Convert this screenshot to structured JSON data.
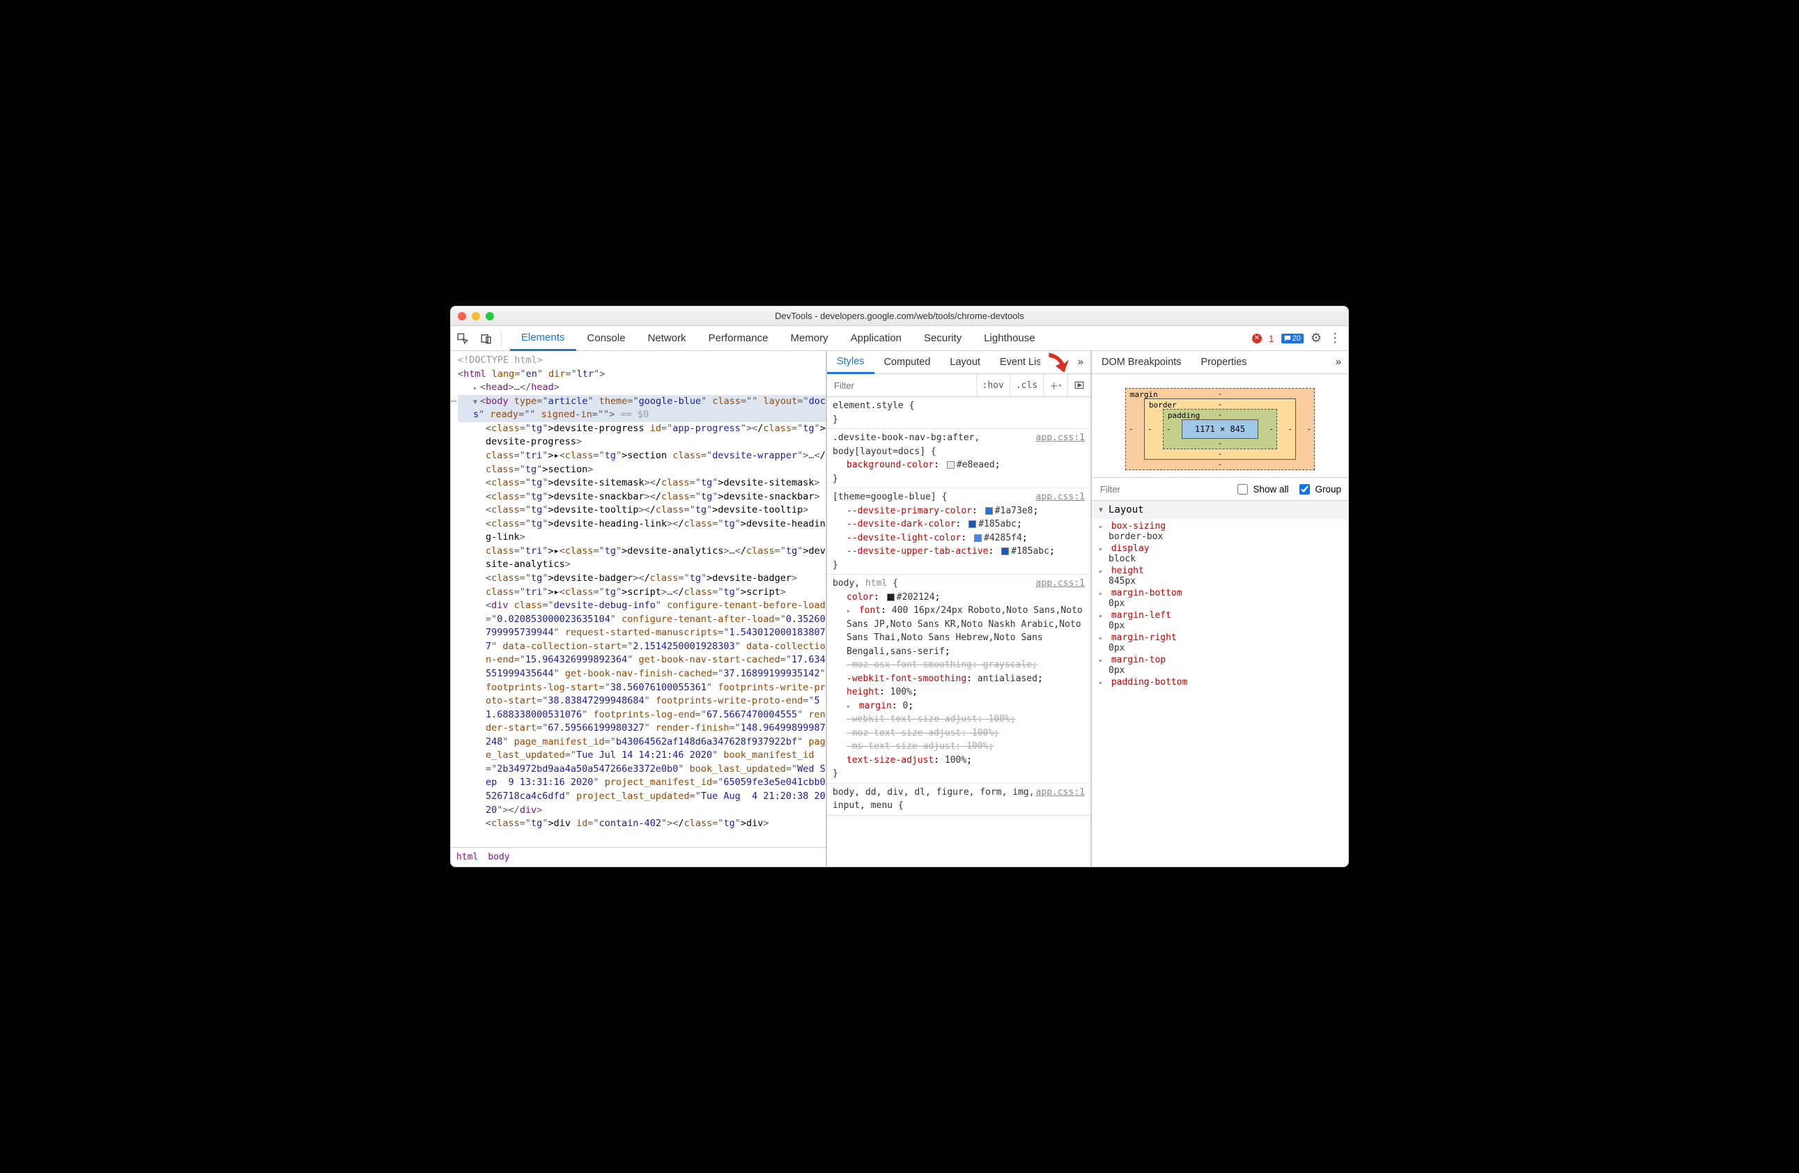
{
  "window": {
    "title": "DevTools - developers.google.com/web/tools/chrome-devtools"
  },
  "main_tabs": [
    "Elements",
    "Console",
    "Network",
    "Performance",
    "Memory",
    "Application",
    "Security",
    "Lighthouse"
  ],
  "main_tabs_active": "Elements",
  "error_count": "1",
  "message_count": "20",
  "dom": {
    "doctype": "<!DOCTYPE html>",
    "html_open": {
      "tag": "html",
      "attrs": [
        [
          "lang",
          "en"
        ],
        [
          "dir",
          "ltr"
        ]
      ]
    },
    "head": {
      "tag": "head"
    },
    "body_open": {
      "tag": "body",
      "attrs": [
        [
          "type",
          "article"
        ],
        [
          "theme",
          "google-blue"
        ],
        [
          "class",
          ""
        ],
        [
          "layout",
          "docs"
        ],
        [
          "ready",
          ""
        ],
        [
          "signed-in",
          ""
        ]
      ],
      "tail": " == $0"
    },
    "children": [
      "<devsite-progress id=\"app-progress\"></devsite-progress>",
      "▸<section class=\"devsite-wrapper\">…</section>",
      "<devsite-sitemask></devsite-sitemask>",
      "<devsite-snackbar></devsite-snackbar>",
      "<devsite-tooltip></devsite-tooltip>",
      "<devsite-heading-link></devsite-heading-link>",
      "▸<devsite-analytics>…</devsite-analytics>",
      "<devsite-badger></devsite-badger>",
      "▸<script>…</script>"
    ],
    "debug_div": {
      "tag": "div",
      "attrs": [
        [
          "class",
          "devsite-debug-info"
        ],
        [
          "configure-tenant-before-load",
          "0.020853000023635104"
        ],
        [
          "configure-tenant-after-load",
          "0.35260799995739944"
        ],
        [
          "request-started-manuscripts",
          "1.5430120001838077"
        ],
        [
          "data-collection-start",
          "2.1514250001928303"
        ],
        [
          "data-collection-end",
          "15.964326999892364"
        ],
        [
          "get-book-nav-start-cached",
          "17.634551999435644"
        ],
        [
          "get-book-nav-finish-cached",
          "37.16899199935142"
        ],
        [
          "footprints-log-start",
          "38.56076100055361"
        ],
        [
          "footprints-write-proto-start",
          "38.83847299948684"
        ],
        [
          "footprints-write-proto-end",
          "51.688338000531076"
        ],
        [
          "footprints-log-end",
          "67.5667470004555"
        ],
        [
          "render-start",
          "67.59566199980327"
        ],
        [
          "render-finish",
          "148.96499899987248"
        ],
        [
          "page_manifest_id",
          "b43064562af148d6a347628f937922bf"
        ],
        [
          "page_last_updated",
          "Tue Jul 14 14:21:46 2020"
        ],
        [
          "book_manifest_id",
          "2b34972bd9aa4a50a547266e3372e0b0"
        ],
        [
          "book_last_updated",
          "Wed Sep  9 13:31:16 2020"
        ],
        [
          "project_manifest_id",
          "65059fe3e5e041cbb0526718ca4c6dfd"
        ],
        [
          "project_last_updated",
          "Tue Aug  4 21:20:38 2020"
        ]
      ]
    },
    "tail_line": "<div id=\"contain-402\"></div>"
  },
  "breadcrumb": [
    "html",
    "body"
  ],
  "styles_tabs": [
    "Styles",
    "Computed",
    "Layout",
    "Event Listeners",
    "DOM Breakpoints",
    "Properties"
  ],
  "styles_tabs_visible3": "Event Listeners",
  "styles_filter_placeholder": "Filter",
  "hov_label": ":hov",
  "cls_label": ".cls",
  "rules": [
    {
      "selector": "element.style",
      "src": "",
      "decls": []
    },
    {
      "selector": ".devsite-book-nav-bg:after,\nbody[layout=docs]",
      "src": "app.css:1",
      "decls": [
        {
          "p": "background-color",
          "v": "#e8eaed",
          "sw": "#e8eaed"
        }
      ]
    },
    {
      "selector": "[theme=google-blue]",
      "src": "app.css:1",
      "decls": [
        {
          "p": "--devsite-primary-color",
          "v": "#1a73e8",
          "sw": "#1a73e8",
          "var": true
        },
        {
          "p": "--devsite-dark-color",
          "v": "#185abc",
          "sw": "#185abc",
          "var": true
        },
        {
          "p": "--devsite-light-color",
          "v": "#4285f4",
          "sw": "#4285f4",
          "var": true
        },
        {
          "p": "--devsite-upper-tab-active",
          "v": "#185abc",
          "sw": "#185abc",
          "var": true
        }
      ]
    },
    {
      "selector": "body, html",
      "selector_inactive": "html",
      "src": "app.css:1",
      "decls": [
        {
          "p": "color",
          "v": "#202124",
          "sw": "#202124"
        },
        {
          "p": "font",
          "v": "400 16px/24px Roboto,Noto Sans,Noto Sans JP,Noto Sans KR,Noto Naskh Arabic,Noto Sans Thai,Noto Sans Hebrew,Noto Sans Bengali,sans-serif",
          "expand": true
        },
        {
          "p": "-moz-osx-font-smoothing",
          "v": "grayscale",
          "strike": true
        },
        {
          "p": "-webkit-font-smoothing",
          "v": "antialiased"
        },
        {
          "p": "height",
          "v": "100%"
        },
        {
          "p": "margin",
          "v": "0",
          "expand": true
        },
        {
          "p": "-webkit-text-size-adjust",
          "v": "100%",
          "strike": true
        },
        {
          "p": "-moz-text-size-adjust",
          "v": "100%",
          "strike": true
        },
        {
          "p": "-ms-text-size-adjust",
          "v": "100%",
          "strike": true
        },
        {
          "p": "text-size-adjust",
          "v": "100%"
        }
      ]
    },
    {
      "selector": "body, dd, div, dl, figure, form, img, input, menu",
      "src": "app.css:1",
      "partial": true,
      "decls": []
    }
  ],
  "box_model": {
    "margin": [
      "-",
      "-",
      "-",
      "-"
    ],
    "border": [
      "-",
      "-",
      "-",
      "-"
    ],
    "padding": [
      "-",
      "-",
      "-",
      "-"
    ],
    "content": "1171 × 845"
  },
  "computed_filter_placeholder": "Filter",
  "show_all_label": "Show all",
  "group_label": "Group",
  "group_checked": true,
  "layout_section_label": "Layout",
  "computed": [
    {
      "p": "box-sizing",
      "v": "border-box"
    },
    {
      "p": "display",
      "v": "block"
    },
    {
      "p": "height",
      "v": "845px"
    },
    {
      "p": "margin-bottom",
      "v": "0px"
    },
    {
      "p": "margin-left",
      "v": "0px"
    },
    {
      "p": "margin-right",
      "v": "0px"
    },
    {
      "p": "margin-top",
      "v": "0px"
    },
    {
      "p": "padding-bottom",
      "v": ""
    }
  ]
}
